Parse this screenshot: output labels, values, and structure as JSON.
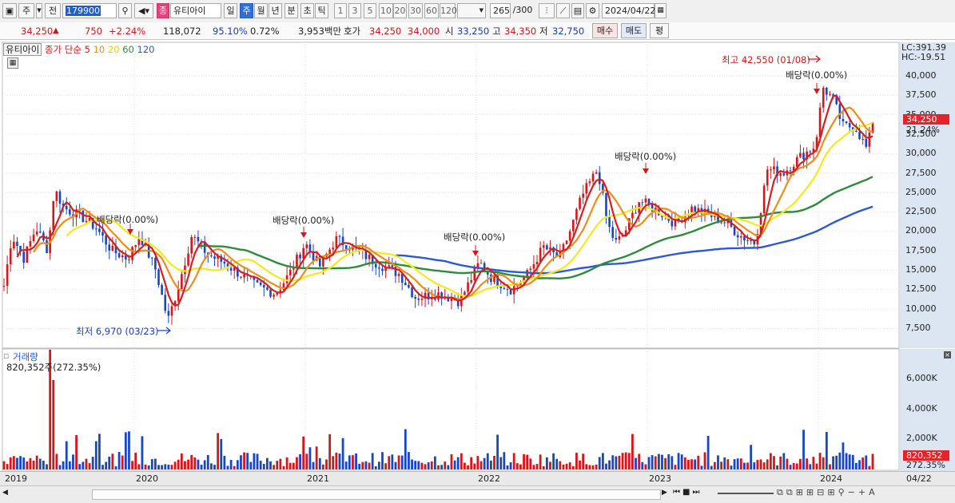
{
  "toolbar": {
    "market_label": "주",
    "prev_label": "전",
    "stock_code": "179900",
    "stock_badge": "종",
    "stock_name": "유티아이",
    "periods": [
      "일",
      "주",
      "월",
      "년",
      "분",
      "초",
      "틱"
    ],
    "active_period": "주",
    "ranges": [
      "1",
      "3",
      "5",
      "10",
      "20",
      "30",
      "60",
      "120"
    ],
    "count_value": "265",
    "count_total": "/300",
    "date_value": "2024/04/22"
  },
  "quote": {
    "price": "34,250",
    "change": "750",
    "change_pct": "+2.24%",
    "volume": "118,072",
    "vol_ratio": "95.10%",
    "turnover": "0.72%",
    "amount": "3,953백만",
    "bid_label": "호가",
    "ask_price": "34,250",
    "bid_price": "34,000",
    "open_label": "시",
    "open": "33,250",
    "high_label": "고",
    "high": "34,350",
    "low_label": "저",
    "low": "32,750",
    "buy_button": "매수",
    "sell_button": "매도",
    "eval_button": "평"
  },
  "legend": {
    "name": "유티아이",
    "ma_prefix": "종가 단순",
    "ma5": "5",
    "ma10": "10",
    "ma20": "20",
    "ma60": "60",
    "ma120": "120"
  },
  "colors": {
    "up": "#d9151c",
    "down": "#1746c8",
    "ma5": "#d42020",
    "ma10": "#f08c1a",
    "ma20": "#f2ea1e",
    "ma60": "#2e8b3c",
    "ma120": "#2b59d6"
  },
  "annotations": {
    "high": "최고 42,550 (01/08)",
    "low": "최저 6,970 (03/23)",
    "dividends": [
      "배당락(0.00%)",
      "배당락(0.00%)",
      "배당락(0.00%)",
      "배당락(0.00%)",
      "배당락(0.00%)"
    ]
  },
  "price_axis": {
    "lc": "LC:391.39",
    "hc": "HC:-19.51",
    "ticks": [
      "40,000",
      "37,500",
      "35,000",
      "32,500",
      "30,000",
      "27,500",
      "25,000",
      "22,500",
      "20,000",
      "17,500",
      "15,000",
      "12,500",
      "10,000",
      "7,500"
    ],
    "current": "34,250",
    "current_pct": "21.24%"
  },
  "volume_panel": {
    "title": "거래량",
    "info": "820,352주(272.35%)",
    "ticks": [
      "6,000K",
      "4,000K",
      "2,000K"
    ],
    "current": "820,352",
    "current_pct": "272.35%"
  },
  "date_axis": {
    "years": [
      "2019",
      "2020",
      "2021",
      "2022",
      "2023",
      "2024"
    ],
    "cursor": "04/22"
  }
}
